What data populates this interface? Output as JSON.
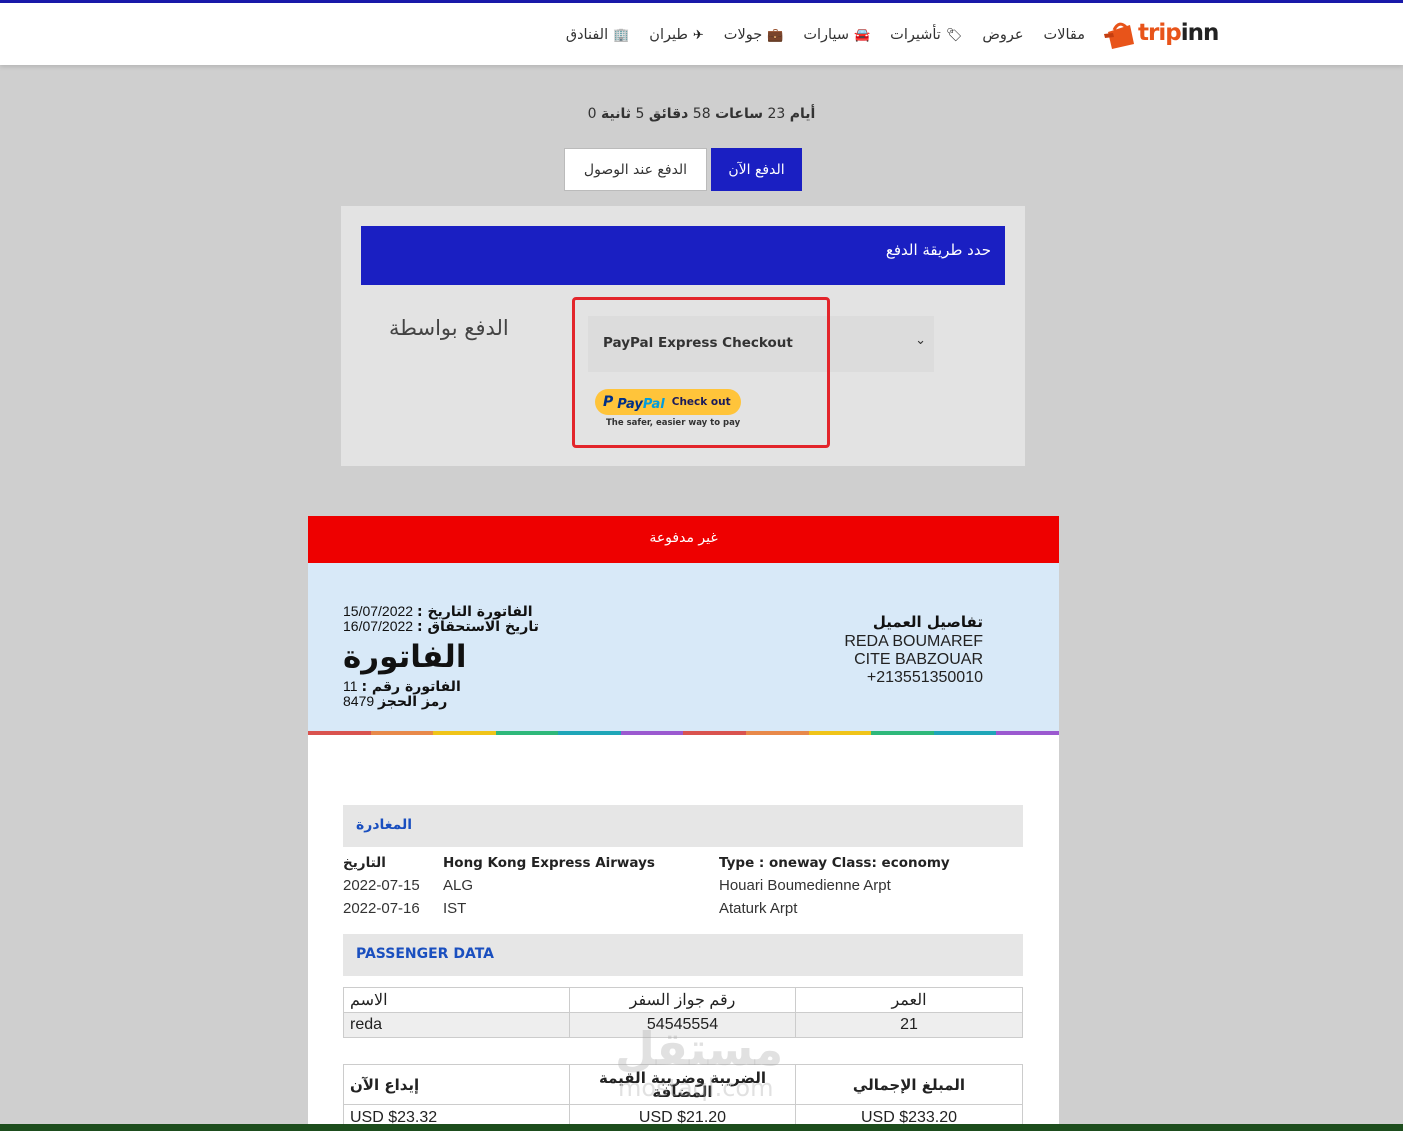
{
  "brand": {
    "logo_a": "trip",
    "logo_b": "inn"
  },
  "nav": [
    {
      "label": "مقالات",
      "icon": ""
    },
    {
      "label": "عروض",
      "icon": ""
    },
    {
      "label": "تأشيرات",
      "icon": "tag-icon"
    },
    {
      "label": "سيارات",
      "icon": "car-icon"
    },
    {
      "label": "جولات",
      "icon": "suitcase-icon"
    },
    {
      "label": "طيران",
      "icon": "plane-icon"
    },
    {
      "label": "الفنادق",
      "icon": "building-icon"
    }
  ],
  "countdown": {
    "days_label": "أيام",
    "hours": "23",
    "hours_label": "ساعات",
    "minutes": "58",
    "minutes_label": "دقائق",
    "seconds": "5",
    "seconds_label": "ثانية",
    "trailing": "0"
  },
  "payment_tabs": {
    "pay_now": "الدفع الآن",
    "pay_on_arrival": "الدفع عند الوصول"
  },
  "payment_method": {
    "header": "حدد طريقة الدفع",
    "pay_by_label": "الدفع بواسطة",
    "selected": "PayPal Express Checkout",
    "paypal_button": {
      "p": "P",
      "pay": "Pay",
      "pal": "Pal",
      "cta": "Check out",
      "tagline": "The safer, easier way to pay"
    }
  },
  "invoice": {
    "status": "غير مدفوعة",
    "date_label": "الفاتورة التاريخ :",
    "date": "15/07/2022",
    "due_label": "تاريخ الاستحقاق :",
    "due": "16/07/2022",
    "title": "الفاتورة",
    "number_label": "الفاتورة رقم :",
    "number": "11",
    "booking_label": "رمز الحجز",
    "booking": "8479",
    "customer": {
      "title": "تفاصيل العميل",
      "name": "REDA BOUMAREF",
      "address": "CITE BABZOUAR",
      "phone": "+213551350010"
    },
    "departure_title": "المغادرة",
    "flight": {
      "col_date_header": "التاريخ",
      "airline": "Hong Kong Express Airways",
      "type": "Type : oneway Class: economy",
      "rows": [
        {
          "date": "2022-07-15",
          "code": "ALG",
          "airport": "Houari Boumedienne Arpt"
        },
        {
          "date": "2022-07-16",
          "code": "IST",
          "airport": "Ataturk Arpt"
        }
      ]
    },
    "passenger_title": "PASSENGER DATA",
    "passenger_headers": {
      "name": "الاسم",
      "passport": "رقم جواز السفر",
      "age": "العمر"
    },
    "passenger": {
      "name": "reda",
      "passport": "54545554",
      "age": "21"
    },
    "totals_headers": {
      "deposit": "إيداع الآن",
      "vat": "الضريبة وضريبة القيمة المضافة",
      "total": "المبلغ الإجمالي"
    },
    "totals": {
      "deposit": "USD $23.32",
      "vat": "USD $21.20",
      "total": "USD $233.20"
    }
  },
  "watermark": {
    "ar": "مستقل",
    "en": "mostaql.com"
  },
  "colors": {
    "primary": "#1a1fc2",
    "unpaid": "#ee0000",
    "invoice_header_bg": "#d8e9f8",
    "highlight": "#e3252b",
    "paypal": "#ffc43a"
  }
}
